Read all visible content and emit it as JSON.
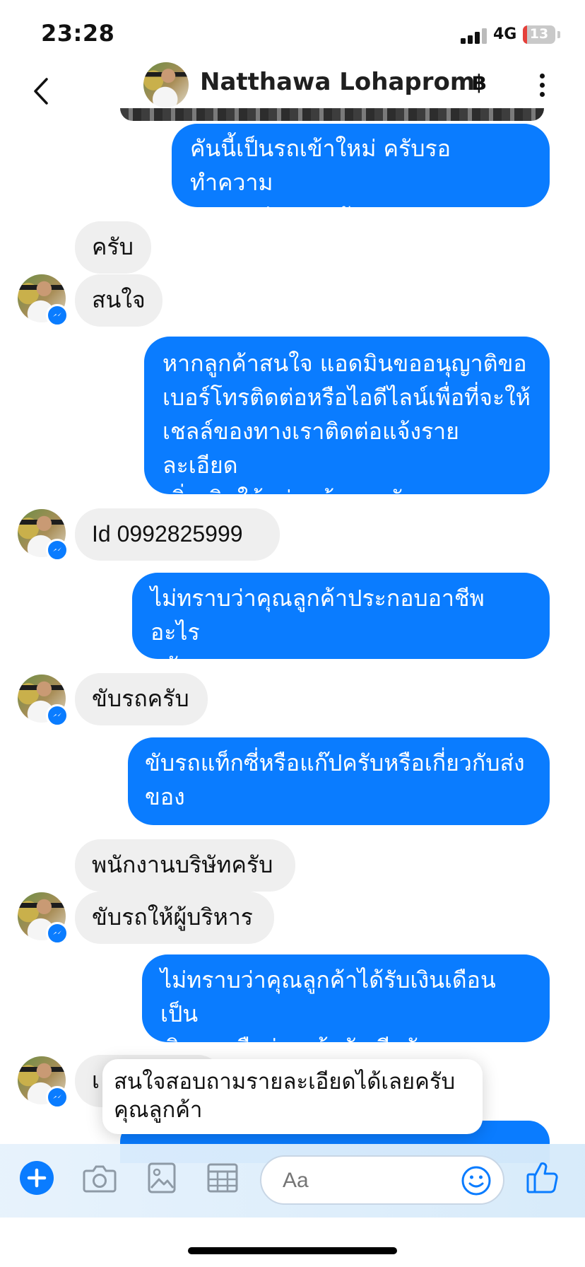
{
  "status_bar": {
    "time": "23:28",
    "network": "4G",
    "battery": "13",
    "battery_level": 0.13
  },
  "header": {
    "contact_name": "Natthawa Lohaprom",
    "currency_symbol": "฿"
  },
  "messages": [
    {
      "sender": "me",
      "text": "คันนี้เป็นรถเข้าใหม่ ครับรอทำความ\nสะอาดถ่ายรูปครับ"
    },
    {
      "sender": "contact",
      "text": "ครับ"
    },
    {
      "sender": "contact",
      "text": "สนใจ"
    },
    {
      "sender": "me",
      "text": "หากลูกค้าสนใจ แอดมินขออนุญาติขอ\nเบอร์โทรติดต่อหรือไอดีไลน์เพื่อที่จะให้\nเชลล์ของทางเราติดต่อแจ้งรายละเอียด\nเพิ่มเติมให้แก่ลูกค้านะครับ"
    },
    {
      "sender": "contact",
      "text": "Id 0992825999"
    },
    {
      "sender": "me",
      "text": "ไม่ทราบว่าคุณลูกค้าประกอบอาชีพอะไร\nครับ"
    },
    {
      "sender": "contact",
      "text": "ขับรถครับ"
    },
    {
      "sender": "me",
      "text": "ขับรถแท็กซี่หรือแก๊ปครับหรือเกี่ยวกับส่ง\nของ"
    },
    {
      "sender": "contact",
      "text": "พนักงานบริษัทครับ"
    },
    {
      "sender": "contact",
      "text": "ขับรถให้ผู้บริหาร"
    },
    {
      "sender": "me",
      "text": "ไม่ทราบว่าคุณลูกค้าได้รับเงินเดือนเป็น\nเงินสดหรือผ่านเข้าบัญชีครับ"
    },
    {
      "sender": "contact",
      "text": "เ"
    }
  ],
  "quick_reply": {
    "text": "สนใจสอบถามรายละเอียดได้เลยครับ\nคุณลูกค้า"
  },
  "composer": {
    "placeholder": "Aa"
  },
  "colors": {
    "outgoing_bubble": "#0a7cff",
    "incoming_bubble": "#efefef",
    "accent": "#0a7cff"
  }
}
